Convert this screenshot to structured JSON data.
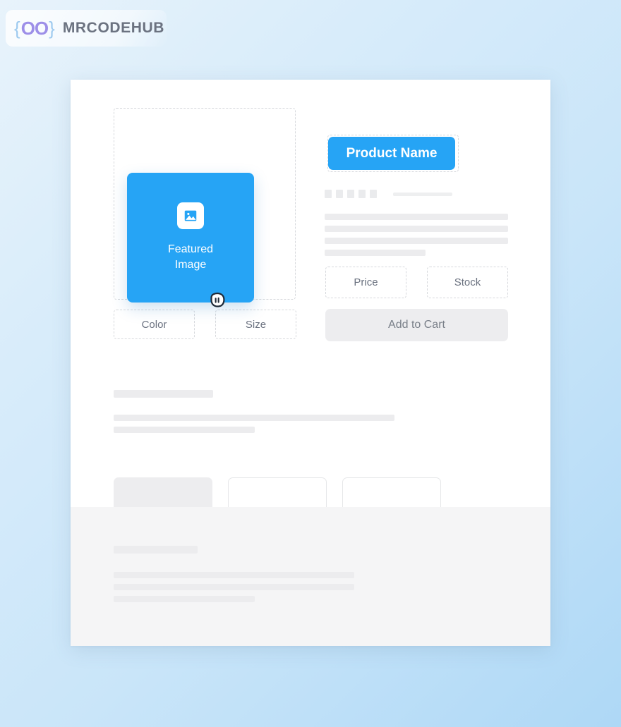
{
  "logo": {
    "brace_open": "{",
    "oo": "OO",
    "brace_close": "}",
    "wordmark": "MRCODEHUB",
    "brace_color": "#9cc9ef",
    "oo_color": "#9d8fe8",
    "wordmark_color": "#6b7280"
  },
  "colors": {
    "accent_blue": "#26a4f5",
    "page_background_start": "#e8f3fb",
    "page_background_end": "#aed8f6",
    "card_background": "#ffffff",
    "skeleton_grey": "#ececee",
    "grey_section": "#f5f5f6",
    "dashed_border": "#d6d8dc"
  },
  "product": {
    "featured_image": {
      "label_line1": "Featured",
      "label_line2": "Image",
      "icon": "image-placeholder-icon"
    },
    "name_label": "Product Name",
    "options": [
      {
        "label": "Color"
      },
      {
        "label": "Size"
      }
    ],
    "fields": [
      {
        "label": "Price"
      },
      {
        "label": "Stock"
      }
    ],
    "add_to_cart_label": "Add to Cart",
    "rating_placeholder_count": 5
  },
  "cursor": {
    "type": "grabbing-hand-cursor"
  },
  "skeleton": {
    "detail_lines": 4,
    "mid_section_lines": 2,
    "grey_section_lines": 3,
    "mini_cards": 3
  }
}
